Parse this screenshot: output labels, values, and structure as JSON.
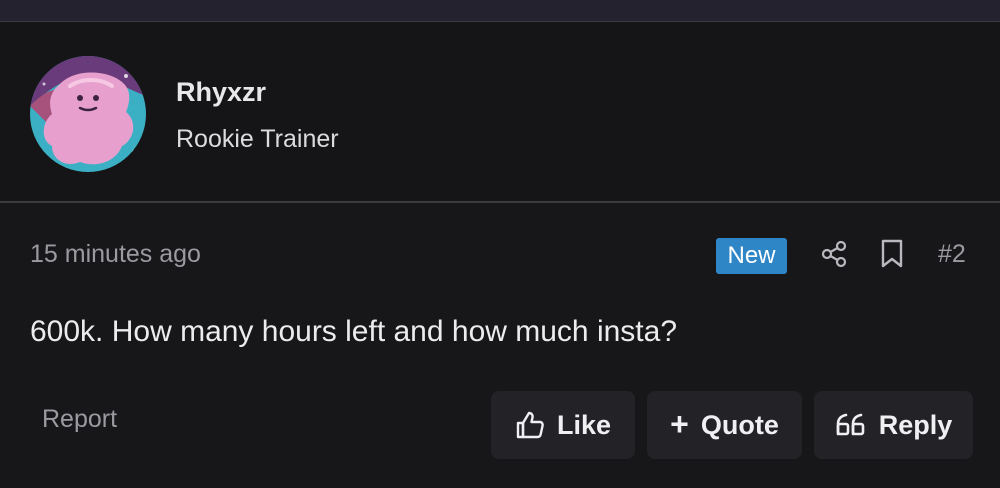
{
  "post": {
    "user": {
      "name": "Rhyxzr",
      "title": "Rookie Trainer",
      "avatar_icon": "ditto-avatar"
    },
    "timestamp": "15 minutes ago",
    "badge": "New",
    "post_number": "#2",
    "message": "600k. How many hours left and how much insta?",
    "icons": {
      "share": "share-icon",
      "bookmark": "bookmark-icon"
    }
  },
  "actions": {
    "report_label": "Report",
    "like_label": "Like",
    "quote_label": "Quote",
    "reply_label": "Reply"
  },
  "colors": {
    "page_background": "#121214",
    "badge_background": "#2f86c6",
    "button_background": "#232327",
    "muted_text": "#9a9aa0"
  }
}
